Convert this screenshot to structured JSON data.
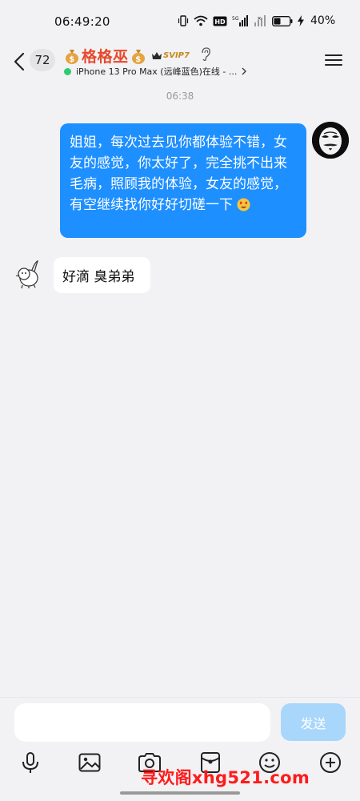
{
  "status_bar": {
    "time": "06:49:20",
    "battery_percent": "40%"
  },
  "header": {
    "unread_count": "72",
    "contact_name": "格格巫",
    "vip_label": "SVIP7",
    "device_status": "iPhone 13 Pro Max (远峰蓝色)在线 - ...",
    "name_color": "#e8482c",
    "online_color": "#2ecc71"
  },
  "chat": {
    "timestamp": "06:38",
    "messages": [
      {
        "direction": "outgoing",
        "text": "姐姐，每次过去见你都体验不错，女友的感觉，你太好了，完全挑不出来毛病，照顾我的体验，女友的感觉，有空继续找你好好切磋一下",
        "emoji": "heart-eyes-emoji",
        "bubble_color": "#1e8fff"
      },
      {
        "direction": "incoming",
        "text": "好滴 臭弟弟",
        "bubble_color": "#ffffff"
      }
    ]
  },
  "composer": {
    "input_value": "",
    "send_label": "发送",
    "send_color": "#a9d6fb"
  },
  "toolbar": {
    "items": [
      "microphone-icon",
      "image-icon",
      "camera-icon",
      "red-packet-icon",
      "emoji-icon",
      "plus-icon"
    ]
  },
  "watermark": {
    "text": "寻欢阁xhg521.com",
    "color": "#ff1b1b"
  }
}
